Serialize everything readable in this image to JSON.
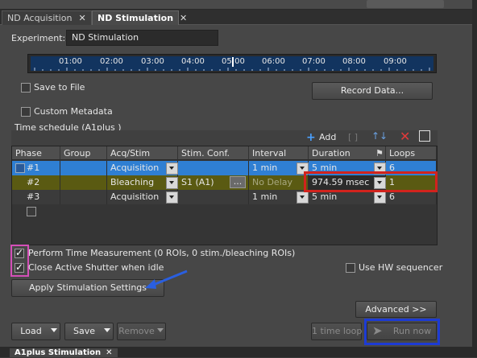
{
  "tabs": [
    {
      "label": "ND Acquisition",
      "close": "✕",
      "active": false
    },
    {
      "label": "ND Stimulation",
      "close": "✕",
      "active": true
    }
  ],
  "experiment": {
    "label": "Experiment:",
    "value": "ND Stimulation"
  },
  "timeline": {
    "ticks": [
      "01:00",
      "02:00",
      "03:00",
      "04:00",
      "05:00",
      "06:00",
      "07:00",
      "08:00",
      "09:00"
    ]
  },
  "save_to_file": {
    "label": "Save to File",
    "checked": false
  },
  "record_data_label": "Record Data...",
  "custom_metadata": {
    "label": "Custom Metadata",
    "checked": false
  },
  "schedule": {
    "title": "Time schedule (A1plus )",
    "add_label": "Add",
    "columns": [
      "Phase",
      "Group",
      "Acq/Stim",
      "Stim. Conf.",
      "Interval",
      "Duration",
      "Loops"
    ],
    "rows": [
      {
        "phase": "#1",
        "group": "",
        "acq": "Acquisition",
        "stim": "",
        "interval": "1 min",
        "duration": "5 min",
        "loops": "6",
        "style": "selected"
      },
      {
        "phase": "#2",
        "group": "",
        "acq": "Bleaching",
        "stim": "S1 (A1)",
        "stim_more": "...",
        "interval": "No Delay",
        "duration": "974.59 msec",
        "loops": "1",
        "style": "bleach"
      },
      {
        "phase": "#3",
        "group": "",
        "acq": "Acquisition",
        "stim": "",
        "interval": "1 min",
        "duration": "5 min",
        "loops": "6",
        "style": "normal"
      }
    ]
  },
  "perform_time_measurement": {
    "label": "Perform Time Measurement (0 ROIs, 0 stim./bleaching ROIs)",
    "checked": true
  },
  "close_shutter": {
    "label": "Close Active Shutter when idle",
    "checked": true
  },
  "use_hw_sequencer": {
    "label": "Use HW sequencer",
    "checked": false
  },
  "apply_stimulation_label": "Apply Stimulation Settings",
  "advanced_label": "Advanced >>",
  "bottom_buttons": {
    "load": "Load",
    "save": "Save",
    "remove": "Remove",
    "one_time_loop": "1 time loop",
    "run_now": "Run now"
  },
  "bottom_tab": {
    "label": "A1plus Stimulation",
    "close": "✕"
  },
  "colors": {
    "selected_row": "#2f7fd3",
    "bleach_row": "#5a5a12",
    "timeline_bar": "#12345f",
    "red_highlight": "#d2231d",
    "pink_highlight": "#d44fb8",
    "blue_highlight": "#1d3bd4",
    "arrow": "#2a5fe0"
  }
}
